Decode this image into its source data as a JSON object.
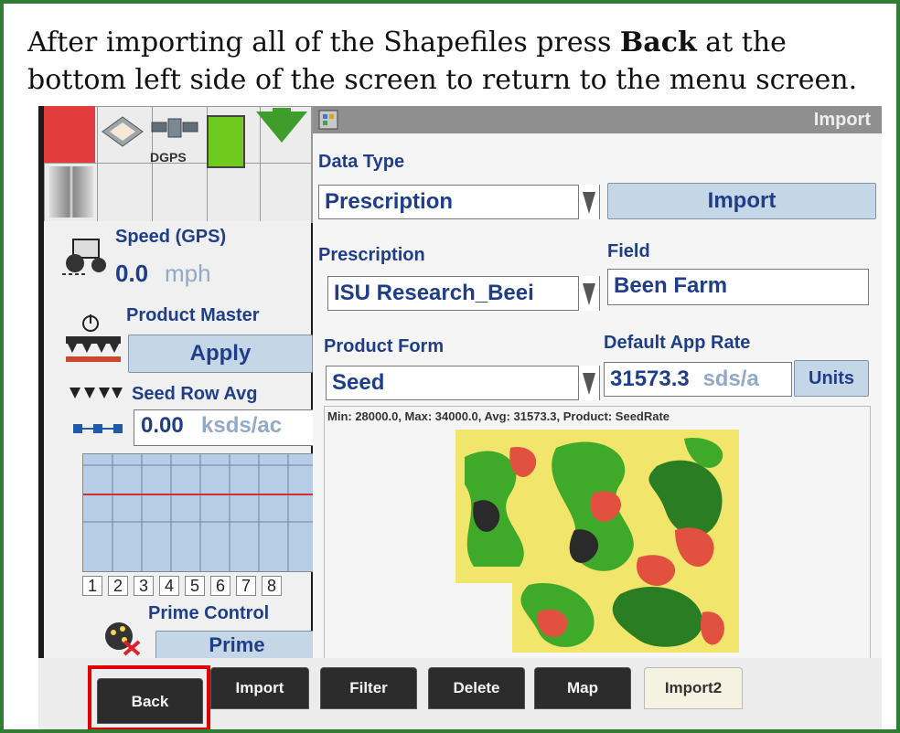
{
  "instruction": {
    "before": "After importing all of the Shapefiles press ",
    "bold": "Back",
    "after": " at the bottom left side of the screen to return to the menu screen."
  },
  "window": {
    "title": "Import"
  },
  "status": {
    "dgps_label": "DGPS"
  },
  "left_panel": {
    "speed_label": "Speed (GPS)",
    "speed_value": "0.0",
    "speed_unit": "mph",
    "product_master_label": "Product Master",
    "apply_button": "Apply",
    "seed_row_label": "Seed Row Avg",
    "seed_row_value": "0.00",
    "seed_row_unit": "ksds/ac",
    "row_numbers": [
      "1",
      "2",
      "3",
      "4",
      "5",
      "6",
      "7",
      "8"
    ],
    "prime_control_label": "Prime Control",
    "prime_button": "Prime"
  },
  "main": {
    "data_type_label": "Data Type",
    "data_type_value": "Prescription",
    "import_button": "Import",
    "prescription_label": "Prescription",
    "prescription_value": "ISU Research_Beei",
    "field_label": "Field",
    "field_value": "Been Farm",
    "product_form_label": "Product Form",
    "product_form_value": "Seed",
    "default_rate_label": "Default App Rate",
    "default_rate_value": "31573.3",
    "default_rate_unit": "sds/a",
    "units_button": "Units",
    "stats_text": "Min: 28000.0, Max: 34000.0, Avg: 31573.3, Product: SeedRate"
  },
  "tabs": [
    {
      "label": "Back",
      "active": false
    },
    {
      "label": "Import",
      "active": false
    },
    {
      "label": "Filter",
      "active": false
    },
    {
      "label": "Delete",
      "active": false
    },
    {
      "label": "Map",
      "active": false
    },
    {
      "label": "Import2",
      "active": true
    }
  ],
  "colors": {
    "frame_border": "#2e7d32",
    "label_blue": "#1f3e8a",
    "map_green": "#3faa2a",
    "map_red": "#e2513f",
    "map_yellow": "#f1e56b",
    "highlight_red": "#e00000"
  }
}
